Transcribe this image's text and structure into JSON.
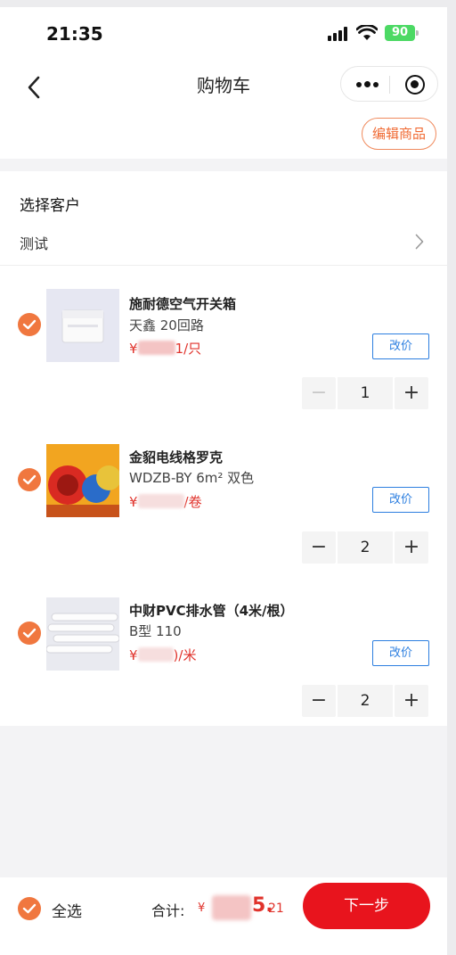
{
  "status_bar": {
    "time": "21:35",
    "battery": "90"
  },
  "nav": {
    "title": "购物车",
    "edit_label": "编辑商品"
  },
  "customer": {
    "section_title": "选择客户",
    "name": "测试"
  },
  "items": [
    {
      "name": "施耐德空气开关箱",
      "spec": "天鑫 20回路",
      "price_prefix": "¥",
      "price_suffix": "1/只",
      "reprice_label": "改价",
      "quantity": "1",
      "minus": "−",
      "plus": "+",
      "checked": true
    },
    {
      "name": "金貂电线格罗克",
      "spec": "WDZB-BY 6m² 双色",
      "price_prefix": "¥",
      "price_suffix": "/卷",
      "reprice_label": "改价",
      "quantity": "2",
      "minus": "−",
      "plus": "+",
      "checked": true
    },
    {
      "name": "中财PVC排水管（4米/根）",
      "spec": "B型 110",
      "price_prefix": "¥",
      "price_suffix": ")/米",
      "reprice_label": "改价",
      "quantity": "2",
      "minus": "−",
      "plus": "+",
      "checked": true
    }
  ],
  "bottom": {
    "select_all_label": "全选",
    "total_label": "合计:",
    "currency": "¥",
    "total_visible_main": "5.",
    "total_visible_decimal": "21",
    "next_label": "下一步"
  },
  "colors": {
    "accent_orange": "#f0773f",
    "price_red": "#e0322b",
    "next_red": "#e8141d",
    "link_blue": "#2d7fe0"
  }
}
